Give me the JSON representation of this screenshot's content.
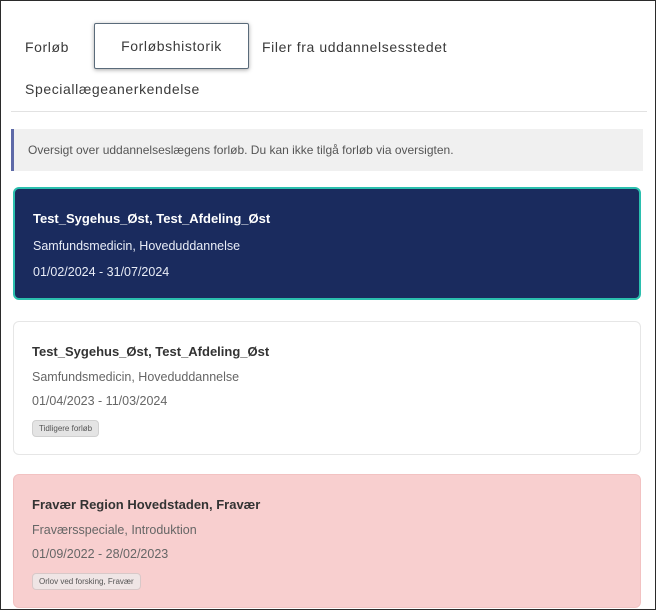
{
  "tabs": [
    {
      "label": "Forløb"
    },
    {
      "label": "Forløbshistorik"
    },
    {
      "label": "Filer fra uddannelsesstedet"
    },
    {
      "label": "Speciallægeanerkendelse"
    }
  ],
  "info": {
    "text": "Oversigt over uddannelseslægens forløb. Du kan ikke tilgå forløb via oversigten."
  },
  "cards": [
    {
      "title": "Test_Sygehus_Øst, Test_Afdeling_Øst",
      "line1": "Samfundsmedicin, Hoveduddannelse",
      "line2": "01/02/2024 - 31/07/2024"
    },
    {
      "title": "Test_Sygehus_Øst, Test_Afdeling_Øst",
      "line1": "Samfundsmedicin, Hoveduddannelse",
      "line2": "01/04/2023 - 11/03/2024",
      "badge": "Tidligere forløb"
    },
    {
      "title": "Fravær Region Hovedstaden, Fravær",
      "line1": "Fraværsspeciale, Introduktion",
      "line2": "01/09/2022 - 28/02/2023",
      "badge": "Orlov ved forsking, Fravær"
    }
  ],
  "colors": {
    "active_card_bg": "#1a2b5e",
    "active_card_border": "#2bbfae",
    "absence_card_bg": "#f8cfcf",
    "info_accent": "#5e6aa8"
  }
}
